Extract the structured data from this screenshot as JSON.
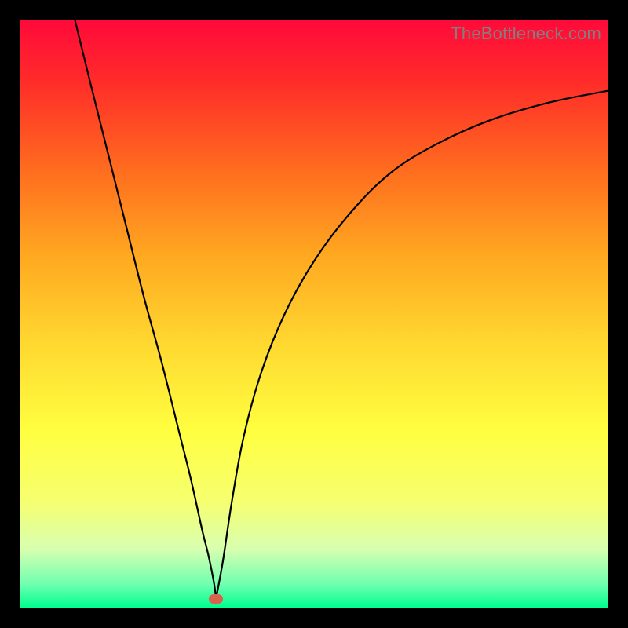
{
  "watermark": "TheBottleneck.com",
  "colors": {
    "dot_fill": "#d9624f",
    "curve_stroke": "#000000",
    "frame_border": "#000000",
    "gradient_stops": [
      {
        "offset": 0.0,
        "color": "#ff0a3a"
      },
      {
        "offset": 0.1,
        "color": "#ff2a2a"
      },
      {
        "offset": 0.25,
        "color": "#ff6a1f"
      },
      {
        "offset": 0.4,
        "color": "#ffa820"
      },
      {
        "offset": 0.55,
        "color": "#ffd830"
      },
      {
        "offset": 0.7,
        "color": "#ffff40"
      },
      {
        "offset": 0.82,
        "color": "#f6ff70"
      },
      {
        "offset": 0.9,
        "color": "#d8ffb0"
      },
      {
        "offset": 0.96,
        "color": "#70ffb0"
      },
      {
        "offset": 1.0,
        "color": "#00ff90"
      }
    ]
  },
  "chart_data": {
    "type": "line",
    "title": "",
    "xlabel": "",
    "ylabel": "",
    "xlim": [
      0,
      1
    ],
    "ylim": [
      0,
      1
    ],
    "minimum_marker": {
      "x": 0.333,
      "y": 0.015
    },
    "series": [
      {
        "name": "left-branch",
        "x": [
          0.093,
          0.12,
          0.15,
          0.18,
          0.21,
          0.24,
          0.27,
          0.29,
          0.31,
          0.32,
          0.33,
          0.333
        ],
        "y": [
          1.0,
          0.89,
          0.77,
          0.65,
          0.53,
          0.42,
          0.3,
          0.22,
          0.13,
          0.09,
          0.04,
          0.015
        ]
      },
      {
        "name": "right-branch",
        "x": [
          0.333,
          0.345,
          0.36,
          0.38,
          0.41,
          0.45,
          0.5,
          0.56,
          0.63,
          0.71,
          0.8,
          0.9,
          1.0
        ],
        "y": [
          0.015,
          0.08,
          0.18,
          0.29,
          0.4,
          0.5,
          0.59,
          0.67,
          0.74,
          0.79,
          0.83,
          0.86,
          0.88
        ]
      }
    ]
  }
}
